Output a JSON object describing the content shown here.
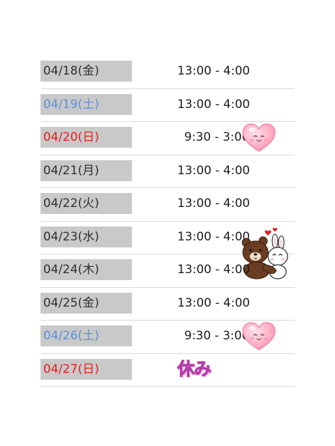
{
  "schedule": [
    {
      "date": "04/18(金)",
      "day_type": "weekday",
      "time": "13:00 - 4:00"
    },
    {
      "date": "04/19(土)",
      "day_type": "sat",
      "time": "13:00 - 4:00"
    },
    {
      "date": "04/20(日)",
      "day_type": "sun",
      "time": "9:30 - 3:00",
      "sticker": "heart-face-icon"
    },
    {
      "date": "04/21(月)",
      "day_type": "weekday",
      "time": "13:00 - 4:00"
    },
    {
      "date": "04/22(火)",
      "day_type": "weekday",
      "time": "13:00 - 4:00"
    },
    {
      "date": "04/23(水)",
      "day_type": "weekday",
      "time": "13:00 - 4:00",
      "sticker": "bear-bunny-hug-sticker"
    },
    {
      "date": "04/24(木)",
      "day_type": "weekday",
      "time": "13:00 - 4:00"
    },
    {
      "date": "04/25(金)",
      "day_type": "weekday",
      "time": "13:00 - 4:00"
    },
    {
      "date": "04/26(土)",
      "day_type": "sat",
      "time": "9:30 - 3:00",
      "sticker": "heart-face-icon"
    },
    {
      "date": "04/27(日)",
      "day_type": "sun",
      "closed_label": "休み"
    }
  ],
  "colors": {
    "weekday": "#2f2f2f",
    "saturday": "#5b8fd8",
    "sunday": "#e0211f",
    "date_background": "#c9c9c9",
    "closed_label": "#e54fc1"
  }
}
